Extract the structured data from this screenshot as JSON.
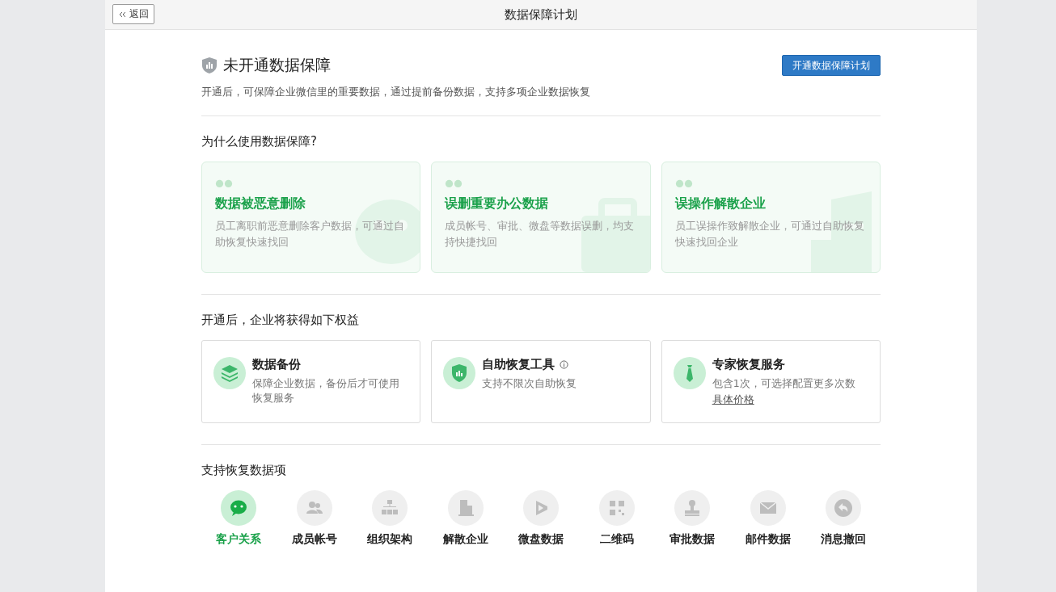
{
  "header": {
    "back": "返回",
    "title": "数据保障计划"
  },
  "status": {
    "title": "未开通数据保障",
    "description": "开通后，可保障企业微信里的重要数据，通过提前备份数据，支持多项企业数据恢复",
    "button": "开通数据保障计划"
  },
  "why": {
    "heading": "为什么使用数据保障?",
    "cards": [
      {
        "kind": "chat",
        "title": "数据被恶意删除",
        "text": "员工离职前恶意删除客户数据，可通过自助恢复快速找回"
      },
      {
        "kind": "briefcase",
        "title": "误删重要办公数据",
        "text": "成员帐号、审批、微盘等数据误删，均支持快捷找回"
      },
      {
        "kind": "building",
        "title": "误操作解散企业",
        "text": "员工误操作致解散企业，可通过自助恢复快速找回企业"
      }
    ]
  },
  "benefits": {
    "heading": "开通后，企业将获得如下权益",
    "items": [
      {
        "kind": "layers",
        "title": "数据备份",
        "text": "保障企业数据，备份后才可使用恢复服务",
        "info": false
      },
      {
        "kind": "shield",
        "title": "自助恢复工具",
        "text": "支持不限次自助恢复",
        "info": true
      },
      {
        "kind": "tie",
        "title": "专家恢复服务",
        "text": "包含1次，可选择配置更多次数",
        "link": "具体价格",
        "info": false
      }
    ]
  },
  "recover": {
    "heading": "支持恢复数据项",
    "items": [
      {
        "kind": "chat",
        "label": "客户关系",
        "selected": true
      },
      {
        "kind": "people",
        "label": "成员帐号",
        "selected": false
      },
      {
        "kind": "org",
        "label": "组织架构",
        "selected": false
      },
      {
        "kind": "building",
        "label": "解散企业",
        "selected": false
      },
      {
        "kind": "drive",
        "label": "微盘数据",
        "selected": false
      },
      {
        "kind": "qr",
        "label": "二维码",
        "selected": false
      },
      {
        "kind": "stamp",
        "label": "审批数据",
        "selected": false
      },
      {
        "kind": "mail",
        "label": "邮件数据",
        "selected": false
      },
      {
        "kind": "undo",
        "label": "消息撤回",
        "selected": false
      }
    ]
  }
}
